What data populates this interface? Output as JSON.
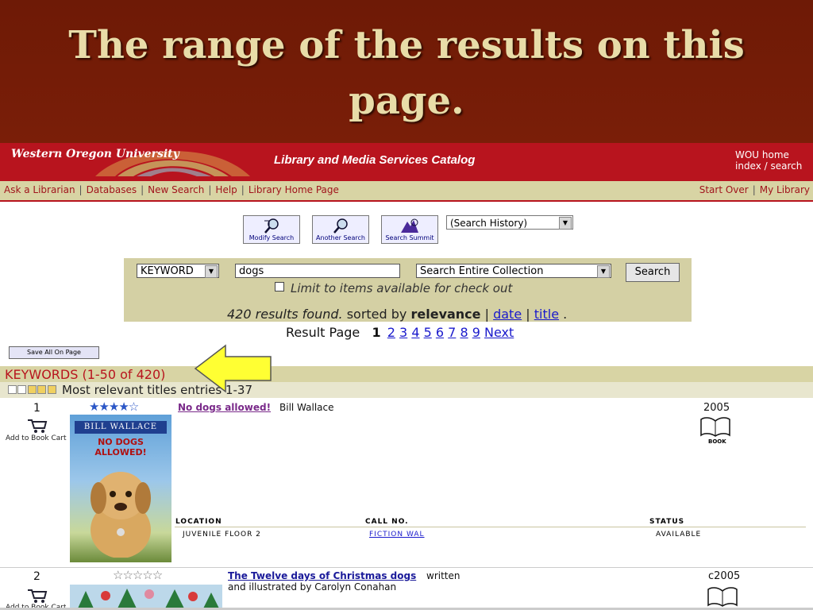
{
  "slide": {
    "title": "The range of the results on this\npage."
  },
  "header": {
    "university": "Western Oregon University",
    "catalog_title": "Library and Media Services Catalog",
    "wou_home": "WOU home",
    "index_search": "index / search"
  },
  "nav": {
    "left": [
      "Ask a Librarian",
      "Databases",
      "New Search",
      "Help",
      "Library Home Page"
    ],
    "right": [
      "Start Over",
      "My Library"
    ]
  },
  "toolbar": {
    "modify": "Modify Search",
    "another": "Another Search",
    "summit": "Search Summit",
    "history": "(Search History)"
  },
  "search": {
    "type": "KEYWORD",
    "query": "dogs",
    "scope": "Search Entire Collection",
    "button": "Search",
    "limit": "Limit to items available for check out",
    "found": "420 results found.",
    "sorted_by": "sorted by",
    "relevance": "relevance",
    "date": "date",
    "title": "title",
    "period": "."
  },
  "paging": {
    "label": "Result Page",
    "current": "1",
    "pages": [
      "2",
      "3",
      "4",
      "5",
      "6",
      "7",
      "8",
      "9"
    ],
    "next": "Next"
  },
  "save_all": "Save All On Page",
  "keywords_label": "KEYWORDS (1-50 of 420)",
  "relevance_label": "Most relevant titles entries 1-37",
  "columns": {
    "location": "LOCATION",
    "callno": "CALL NO.",
    "status": "STATUS"
  },
  "results": [
    {
      "num": "1",
      "cart": "Add to Book Cart",
      "stars": "★★★★☆",
      "title": "No dogs allowed!",
      "author": "Bill Wallace",
      "year": "2005",
      "format": "BOOK",
      "cover_author": "BILL WALLACE",
      "cover_title": "NO DOGS ALLOWED!",
      "location": "JUVENILE FLOOR 2",
      "callno": "FICTION WAL",
      "status": "AVAILABLE"
    },
    {
      "num": "2",
      "cart": "Add to Book Cart",
      "stars": "☆☆☆☆☆",
      "title": "The Twelve days of Christmas dogs",
      "author": "written and illustrated by Carolyn Conahan",
      "year": "c2005"
    }
  ],
  "colors": {
    "slide_bg": "#7a1e08",
    "header_red": "#b8141e",
    "nav_bg": "#d8d4a4",
    "title_text": "#e8dca8"
  }
}
